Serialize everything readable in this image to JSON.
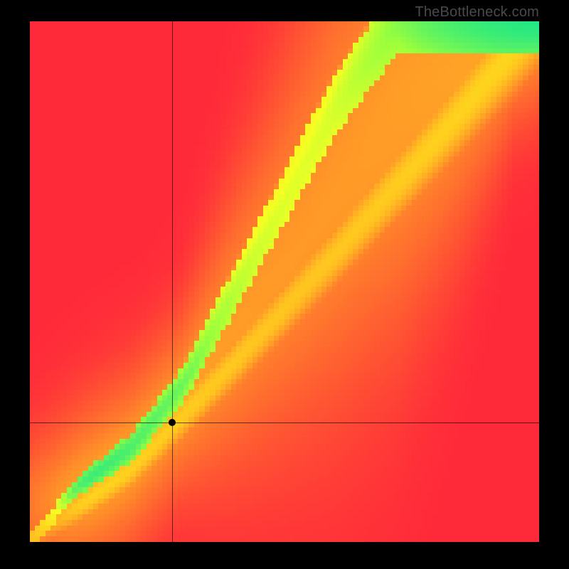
{
  "branding": {
    "watermark": "TheBottleneck.com"
  },
  "chart_data": {
    "type": "heatmap",
    "title": "",
    "xlabel": "",
    "ylabel": "",
    "xlim": [
      0,
      100
    ],
    "ylim": [
      0,
      100
    ],
    "grid": false,
    "annotations": [],
    "marker": {
      "x": 28,
      "y": 23,
      "label": ""
    },
    "crosshair": {
      "x": 28,
      "y": 23
    },
    "optimal_band": {
      "description": "green optimal-performance ridge, roughly y ≈ 1.7·x with curvature at low end; width narrowing toward origin",
      "anchors": [
        {
          "x": 0,
          "y_center": 0,
          "half_width": 1
        },
        {
          "x": 10,
          "y_center": 11,
          "half_width": 2
        },
        {
          "x": 20,
          "y_center": 18,
          "half_width": 3
        },
        {
          "x": 30,
          "y_center": 30,
          "half_width": 4
        },
        {
          "x": 40,
          "y_center": 48,
          "half_width": 5
        },
        {
          "x": 50,
          "y_center": 66,
          "half_width": 6
        },
        {
          "x": 60,
          "y_center": 84,
          "half_width": 7
        },
        {
          "x": 72,
          "y_center": 100,
          "half_width": 8
        }
      ]
    },
    "secondary_band": {
      "description": "faint yellow secondary diagonal below main ridge",
      "anchors": [
        {
          "x": 0,
          "y_center": 0,
          "half_width": 2
        },
        {
          "x": 20,
          "y_center": 14,
          "half_width": 3
        },
        {
          "x": 40,
          "y_center": 34,
          "half_width": 4
        },
        {
          "x": 60,
          "y_center": 55,
          "half_width": 5
        },
        {
          "x": 80,
          "y_center": 77,
          "half_width": 6
        },
        {
          "x": 100,
          "y_center": 100,
          "half_width": 7
        }
      ]
    },
    "color_scale": {
      "stops": [
        {
          "t": 0.0,
          "hex": "#ff2a3a"
        },
        {
          "t": 0.4,
          "hex": "#ff7a2d"
        },
        {
          "t": 0.7,
          "hex": "#ffd21e"
        },
        {
          "t": 0.86,
          "hex": "#f6ff23"
        },
        {
          "t": 0.93,
          "hex": "#9dff3c"
        },
        {
          "t": 1.0,
          "hex": "#19e68a"
        }
      ]
    },
    "pixelation": 96
  }
}
